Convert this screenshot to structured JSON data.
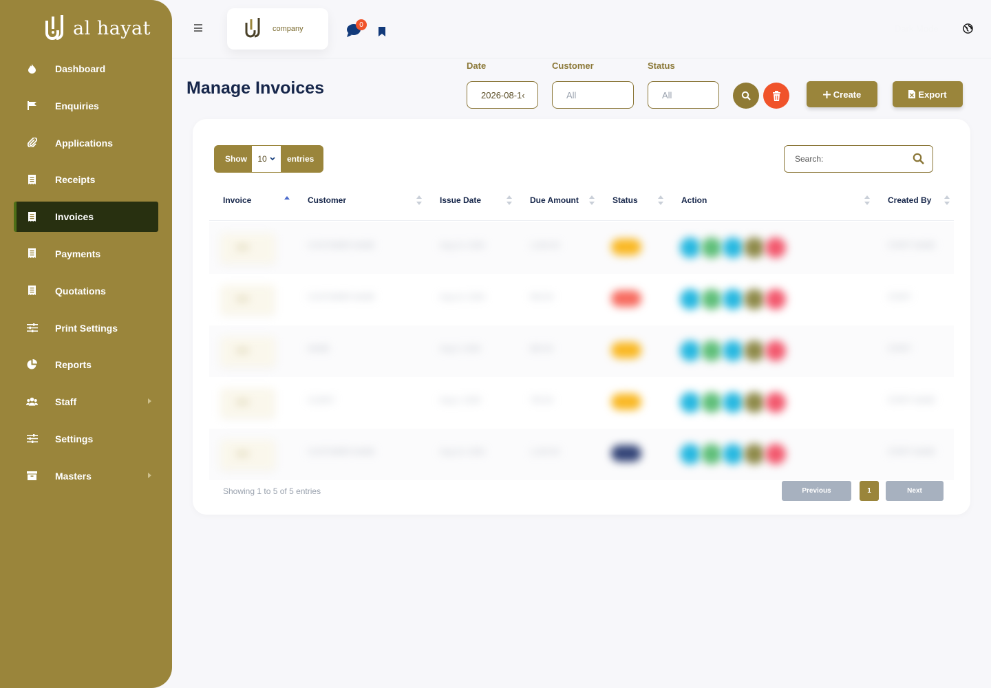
{
  "app": {
    "brand_name": "al hayat",
    "company_name": "company",
    "notification_count": "0",
    "dark_mode_label": "Dark Mode"
  },
  "colors": {
    "sidebar": "#9a853b",
    "active_nav": "#283010",
    "accent": "#9a853b",
    "danger": "#f0532a",
    "title": "#16264a"
  },
  "sidebar": {
    "items": [
      {
        "label": "Dashboard",
        "icon": "flame-icon"
      },
      {
        "label": "Enquiries",
        "icon": "flag-icon"
      },
      {
        "label": "Applications",
        "icon": "paperclip-icon"
      },
      {
        "label": "Receipts",
        "icon": "receipt-icon"
      },
      {
        "label": "Invoices",
        "icon": "receipt-icon",
        "active": true
      },
      {
        "label": "Payments",
        "icon": "receipt-icon"
      },
      {
        "label": "Quotations",
        "icon": "receipt-icon"
      },
      {
        "label": "Print Settings",
        "icon": "sliders-icon"
      },
      {
        "label": "Reports",
        "icon": "pie-chart-icon"
      },
      {
        "label": "Staff",
        "icon": "users-icon",
        "has_submenu": true
      },
      {
        "label": "Settings",
        "icon": "sliders-icon"
      },
      {
        "label": "Masters",
        "icon": "archive-icon",
        "has_submenu": true
      }
    ]
  },
  "page": {
    "title": "Manage Invoices"
  },
  "filters": {
    "date_label": "Date",
    "date_value": "2026-08-1‹",
    "customer_label": "Customer",
    "customer_value": "All",
    "status_label": "Status",
    "status_value": "All"
  },
  "actions": {
    "create_label": "Create",
    "export_label": "Export"
  },
  "table": {
    "show_label": "Show",
    "page_size": "10",
    "entries_label": "entries",
    "search_placeholder": "Search:",
    "columns": [
      "Invoice",
      "Customer",
      "Issue Date",
      "Due Amount",
      "Status",
      "Action",
      "Created By"
    ],
    "info": "Showing 1 to 5 of 5 entries",
    "pagination": {
      "previous": "Previous",
      "current": "1",
      "next": "Next"
    },
    "rows": [
      {
        "invoice": "INV-",
        "customer": "CUSTOMER NAME",
        "issue_date": "Aug 14, 2026",
        "due_amount": "1,200.00",
        "status_color": "#f9b824",
        "created_by": "STAFF NAME"
      },
      {
        "invoice": "INV-",
        "customer": "CUSTOMER NAME",
        "issue_date": "Aug 14, 2026",
        "due_amount": "500.00",
        "status_color": "#f76b5f",
        "created_by": "STAFF"
      },
      {
        "invoice": "INV-",
        "customer": "NAME",
        "issue_date": "Aug 3, 2026",
        "due_amount": "800.00",
        "status_color": "#f9b824",
        "created_by": "STAFF"
      },
      {
        "invoice": "INV-",
        "customer": "CLIENT",
        "issue_date": "Aug 2, 2026",
        "due_amount": "750.00",
        "status_color": "#f9b824",
        "created_by": "STAFF NAME"
      },
      {
        "invoice": "INV-",
        "customer": "CUSTOMER NAME",
        "issue_date": "Aug 10, 2026",
        "due_amount": "1,100.00",
        "status_color": "#334477",
        "created_by": "STAFF NAME"
      }
    ],
    "action_colors": [
      "#27b8e0",
      "#5fbf7a",
      "#27b8e0",
      "#8e8a4a",
      "#f2596e"
    ]
  }
}
